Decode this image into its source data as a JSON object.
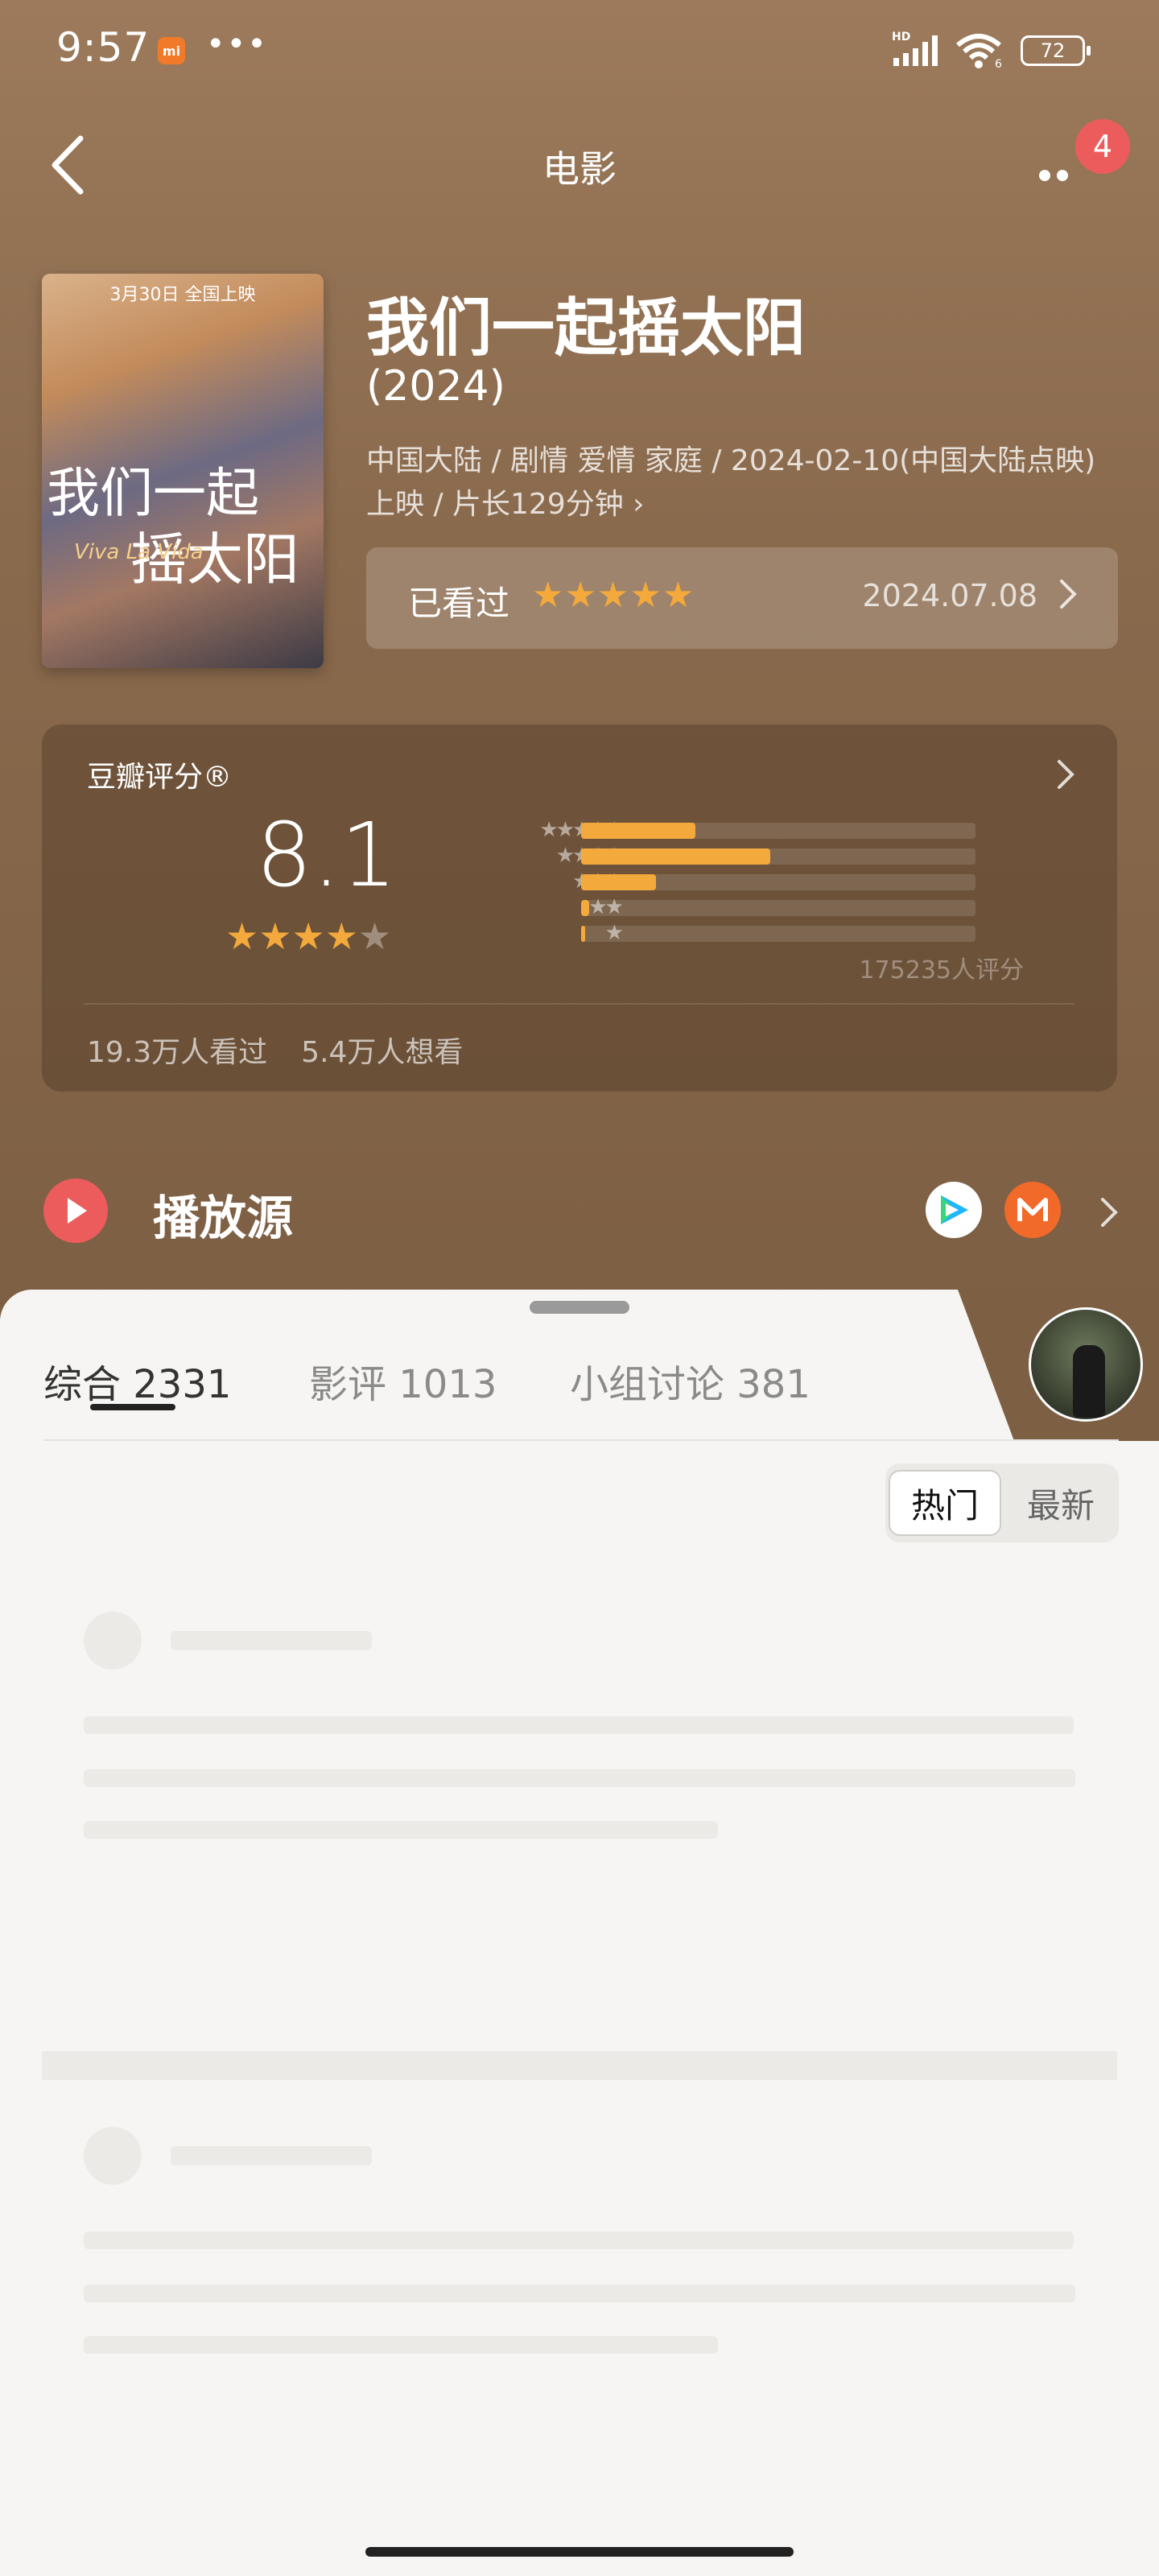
{
  "status_bar": {
    "time": "9:57",
    "mi_label": "mi",
    "dots": "•••",
    "network": "HD",
    "wifi_sub": "6",
    "battery": "72"
  },
  "nav": {
    "title": "电影",
    "notification_count": "4"
  },
  "poster": {
    "top_text": "3月30日 全国上映",
    "title_line1": "我们一起",
    "title_line2": "摇太阳",
    "subtitle": "Viva La Vida"
  },
  "movie": {
    "title": "我们一起摇太阳",
    "year": "(2024)",
    "meta": "中国大陆 / 剧情 爱情 家庭 / 2024-02-10(中国大陆点映)上映 / 片长129分钟 ›",
    "watched_label": "已看过",
    "watched_stars": "★★★★★",
    "watched_date": "2024.07.08"
  },
  "rating": {
    "heading": "豆瓣评分®",
    "score": "8.1",
    "stars_filled": "★★★★",
    "stars_empty": "★",
    "distribution": [
      {
        "stars": "★★★★★",
        "percent": 29
      },
      {
        "stars": "★★★★",
        "percent": 48
      },
      {
        "stars": "★★★",
        "percent": 19
      },
      {
        "stars": "★★",
        "percent": 2
      },
      {
        "stars": "★",
        "percent": 1
      }
    ],
    "count": "175235人评分",
    "watched": "19.3万人看过",
    "want": "5.4万人想看"
  },
  "play": {
    "label": "播放源"
  },
  "tabs": [
    {
      "label": "综合 2331"
    },
    {
      "label": "影评 1013"
    },
    {
      "label": "小组讨论 381"
    }
  ],
  "sort": {
    "hot": "热门",
    "new": "最新"
  },
  "colors": {
    "accent": "#f3a93b",
    "hero": "#8a6a4d",
    "badge": "#ec5c5c"
  }
}
